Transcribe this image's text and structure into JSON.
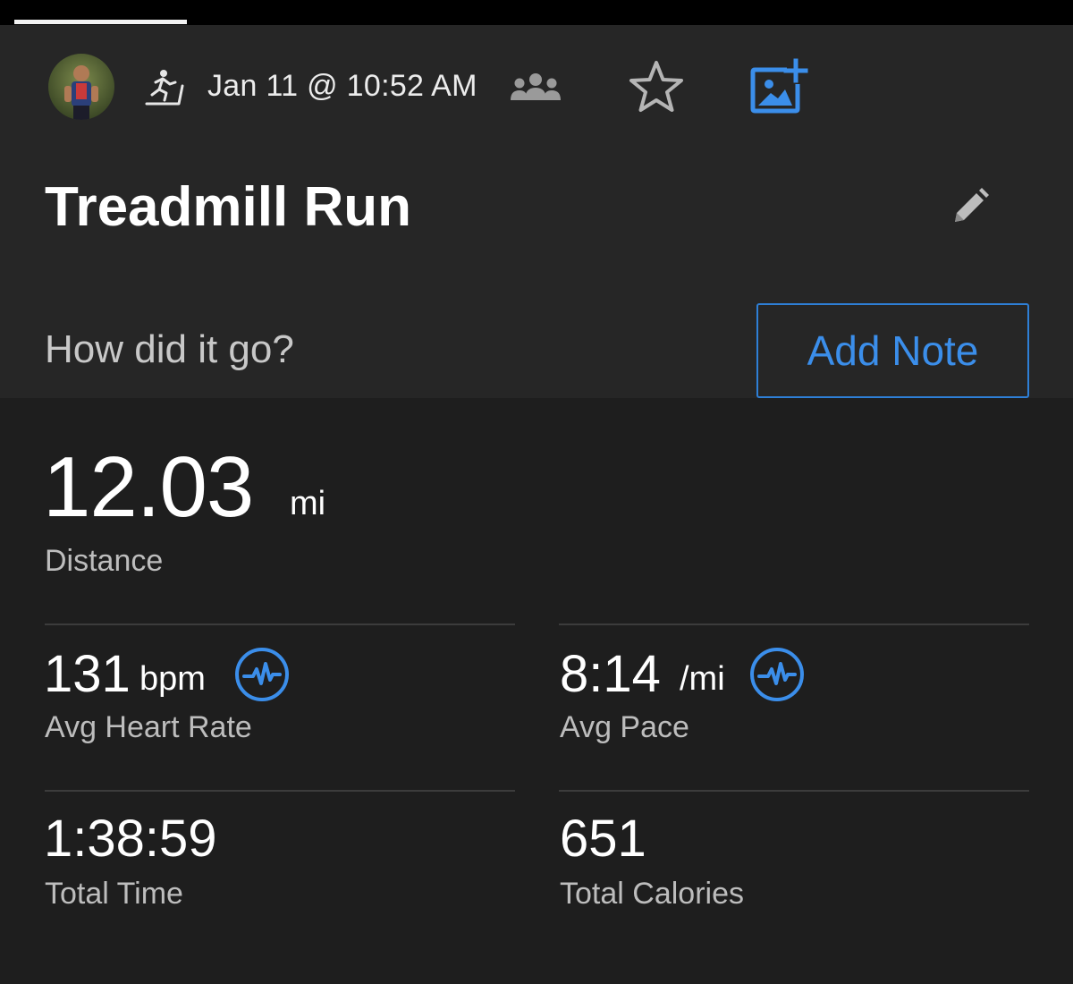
{
  "header": {
    "date": "Jan 11 @ 10:52 AM",
    "icons": [
      "avatar",
      "treadmill-run-icon",
      "group-icon",
      "star-icon",
      "add-photo-icon"
    ]
  },
  "activity": {
    "title": "Treadmill Run",
    "prompt": "How did it go?",
    "add_note_label": "Add Note"
  },
  "stats": {
    "distance": {
      "value": "12.03",
      "unit": "mi",
      "label": "Distance"
    },
    "avg_heart_rate": {
      "value": "131",
      "unit": "bpm",
      "label": "Avg Heart Rate"
    },
    "avg_pace": {
      "value": "8:14",
      "unit": "/mi",
      "label": "Avg Pace"
    },
    "total_time": {
      "value": "1:38:59",
      "label": "Total Time"
    },
    "total_calories": {
      "value": "651",
      "label": "Total Calories"
    }
  },
  "colors": {
    "accent": "#2e7fd6",
    "background": "#1e1e1e",
    "header_background": "#262626",
    "label_text": "#bdbdbd"
  }
}
